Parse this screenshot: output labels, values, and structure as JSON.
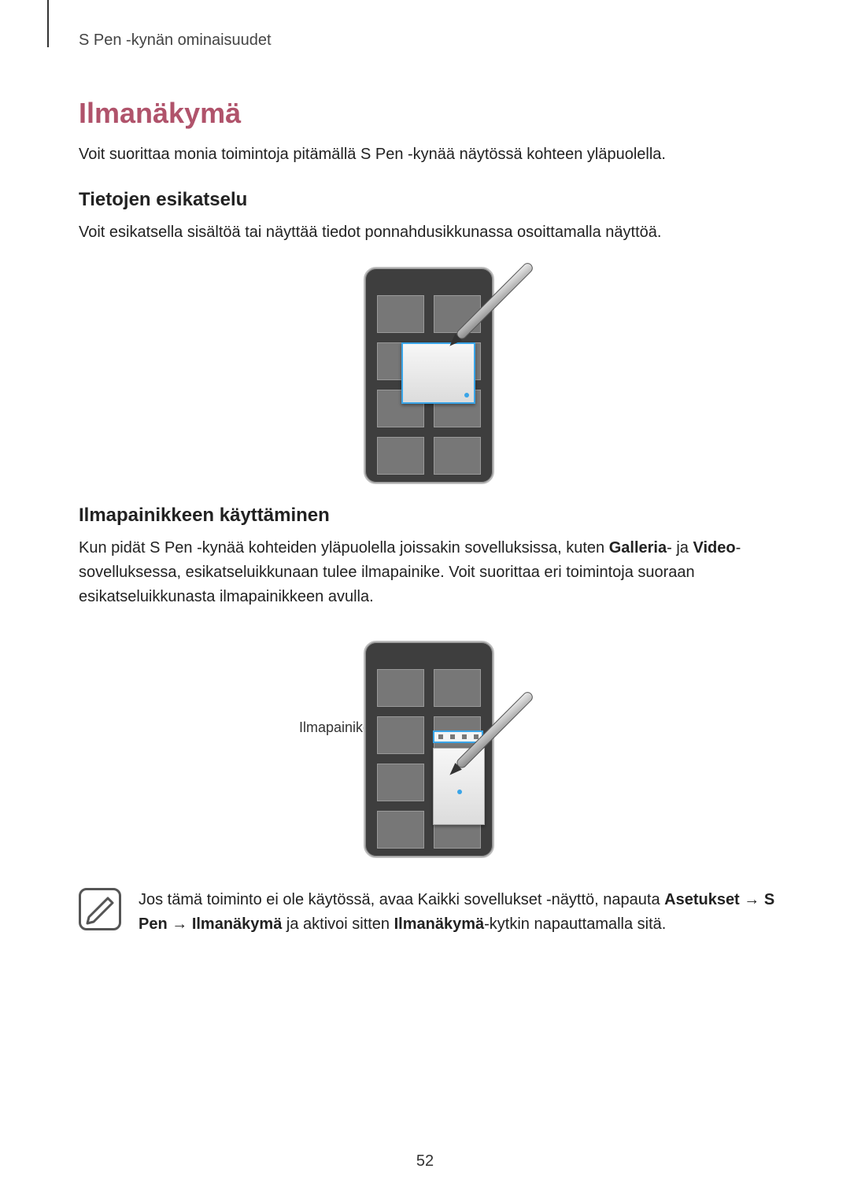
{
  "header": {
    "section": "S Pen -kynän ominaisuudet"
  },
  "title": "Ilmanäkymä",
  "intro": "Voit suorittaa monia toimintoja pitämällä S Pen -kynää näytössä kohteen yläpuolella.",
  "sub1": {
    "heading": "Tietojen esikatselu",
    "text": "Voit esikatsella sisältöä tai näyttää tiedot ponnahdusikkunassa osoittamalla näyttöä."
  },
  "sub2": {
    "heading": "Ilmapainikkeen käyttäminen",
    "text_before_bold1": "Kun pidät S Pen -kynää kohteiden yläpuolella joissakin sovelluksissa, kuten ",
    "bold1": "Galleria",
    "mid1": "- ja ",
    "bold2": "Video",
    "after": "-sovelluksessa, esikatseluikkunaan tulee ilmapainike. Voit suorittaa eri toimintoja suoraan esikatseluikkunasta ilmapainikkeen avulla.",
    "callout": "Ilmapainike"
  },
  "note": {
    "t1": "Jos tämä toiminto ei ole käytössä, avaa Kaikki sovellukset -näyttö, napauta ",
    "b1": "Asetukset",
    "arrow": " → ",
    "b2": "S Pen",
    "b3": "Ilmanäkymä",
    "t2": " ja aktivoi sitten ",
    "b4": "Ilmanäkymä",
    "t3": "-kytkin napauttamalla sitä."
  },
  "page_number": "52"
}
